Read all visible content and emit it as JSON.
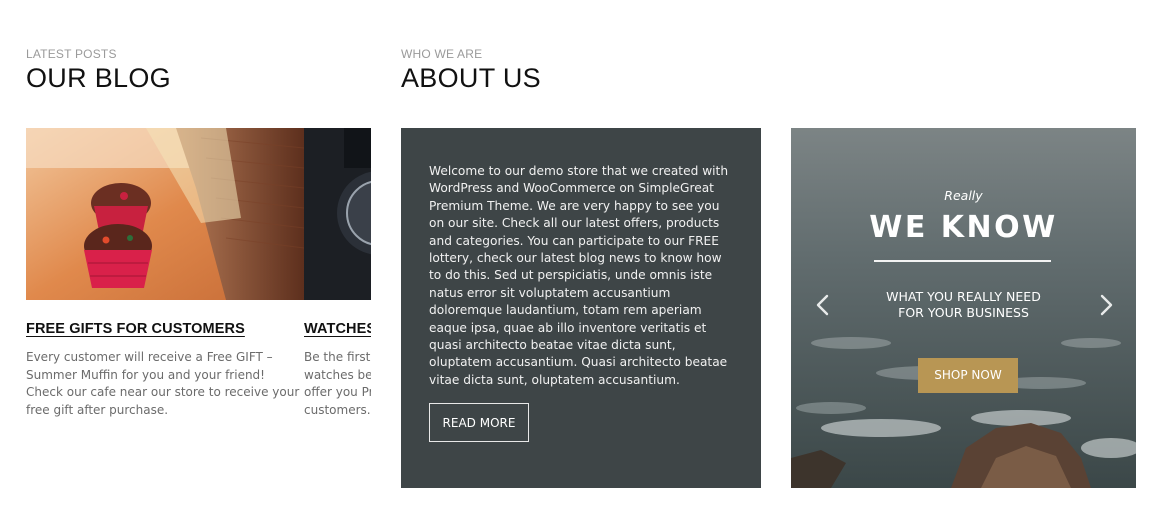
{
  "blog": {
    "eyebrow": "LATEST POSTS",
    "heading": "OUR BLOG",
    "posts": [
      {
        "title": "FREE GIFTS FOR CUSTOMERS",
        "excerpt": "Every customer will receive a Free GIFT – Summer Muffin for you and your friend! Check our cafe near our store to receive your free gift after purchase.",
        "image": "cupcake-photo"
      },
      {
        "title": "WATCHES",
        "excerpt": "Be the first to see our new collection of watches before Sale begins. This season we offer you Premium brands for our loyal customers. Discover more.",
        "image": "watch-photo"
      }
    ]
  },
  "about": {
    "eyebrow": "WHO WE ARE",
    "heading": "ABOUT US",
    "body": "Welcome to our demo store that we created with WordPress and WooCommerce on SimpleGreat Premium Theme. We are very happy to see you on our site. Check all our latest offers, products and categories. You can participate to our FREE lottery, check our latest blog news to know how to do this. Sed ut perspiciatis, unde omnis iste natus error sit voluptatem accusantium doloremque laudantium, totam rem aperiam eaque ipsa, quae ab illo inventore veritatis et quasi architecto beatae vitae dicta sunt, oluptatem accusantium. Quasi architecto beatae vitae dicta sunt, oluptatem accusantium.",
    "button": "READ MORE"
  },
  "promo": {
    "eyebrow": "Really",
    "title": "WE KNOW",
    "subtitle_line1": "WHAT YOU REALLY NEED",
    "subtitle_line2": "FOR YOUR BUSINESS",
    "button": "SHOP NOW",
    "background": "ocean-coast-photo",
    "accent_color": "#b89654"
  },
  "colors": {
    "about_bg": "#3e4547",
    "button_gold": "#b89654"
  }
}
